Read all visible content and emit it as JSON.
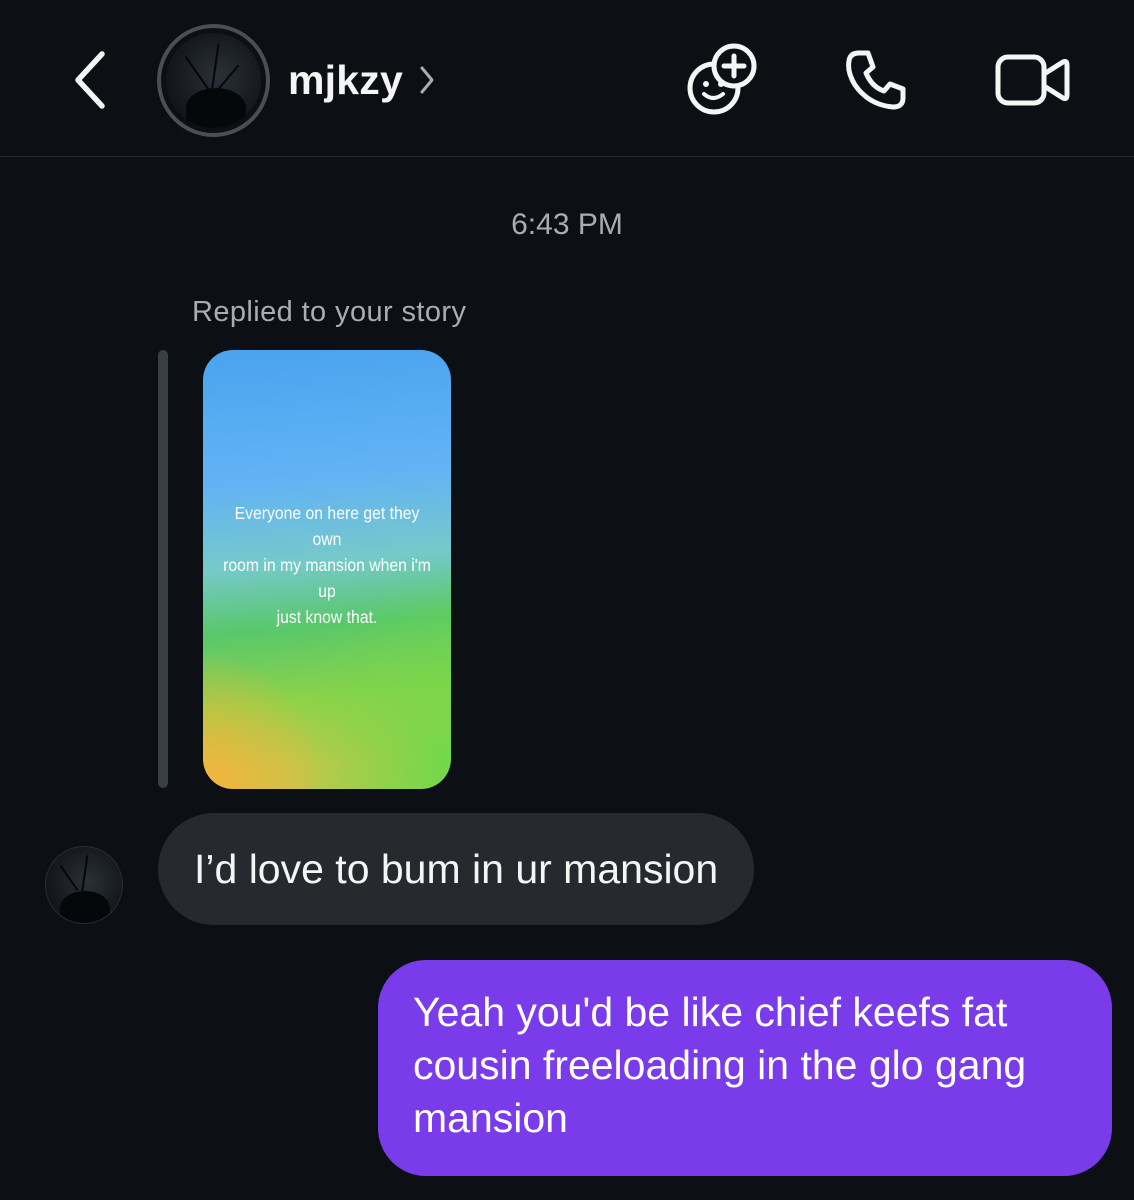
{
  "header": {
    "back_icon": "chevron-left-icon",
    "username": "mjkzy",
    "username_chevron_icon": "chevron-right-icon",
    "actions": [
      {
        "name": "add-people-icon"
      },
      {
        "name": "phone-icon"
      },
      {
        "name": "video-camera-icon"
      }
    ]
  },
  "chat": {
    "timestamp": "6:43 PM",
    "reply_label": "Replied to your story",
    "story": {
      "text_line1": "Everyone on here get they own",
      "text_line2": "room in my mansion when i'm up",
      "text_line3": "just know that."
    },
    "messages": [
      {
        "direction": "incoming",
        "text": "I’d love to bum in ur mansion"
      },
      {
        "direction": "outgoing",
        "line1": "Yeah you'd be like chief keefs fat",
        "line2": "cousin freeloading in the glo gang",
        "line3": "mansion"
      }
    ]
  },
  "colors": {
    "background": "#0c1014",
    "incoming_bubble": "#262a2f",
    "outgoing_bubble": "#7a3cea",
    "secondary_text": "#a8adb3"
  }
}
